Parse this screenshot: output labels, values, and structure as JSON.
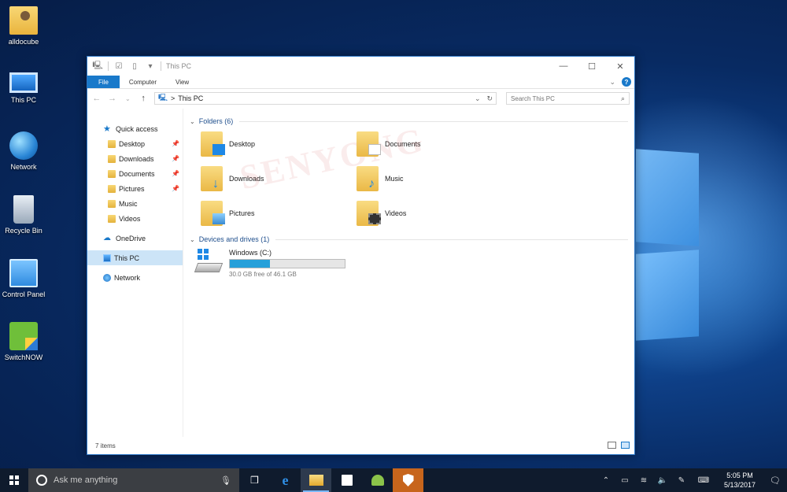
{
  "desktop": {
    "icons": [
      {
        "label": "alldocube",
        "icon": "user-folder-icon"
      },
      {
        "label": "This PC",
        "icon": "computer-icon"
      },
      {
        "label": "Network",
        "icon": "network-icon"
      },
      {
        "label": "Recycle Bin",
        "icon": "recycle-bin-icon"
      },
      {
        "label": "Control Panel",
        "icon": "control-panel-icon"
      },
      {
        "label": "SwitchNOW",
        "icon": "switchnow-icon"
      }
    ]
  },
  "window": {
    "title": "This PC",
    "controls": {
      "minimize": "—",
      "maximize": "☐",
      "close": "✕"
    },
    "ribbon_tabs": [
      "File",
      "Computer",
      "View"
    ],
    "address": {
      "path": "This PC",
      "separator": ">"
    },
    "search": {
      "placeholder": "Search This PC"
    },
    "nav_pane": {
      "quick_access": "Quick access",
      "quick_items": [
        {
          "label": "Desktop",
          "pinned": true
        },
        {
          "label": "Downloads",
          "pinned": true
        },
        {
          "label": "Documents",
          "pinned": true
        },
        {
          "label": "Pictures",
          "pinned": true
        },
        {
          "label": "Music",
          "pinned": false
        },
        {
          "label": "Videos",
          "pinned": false
        }
      ],
      "onedrive": "OneDrive",
      "this_pc": "This PC",
      "network": "Network"
    },
    "folders_section": "Folders (6)",
    "folders": [
      {
        "label": "Desktop",
        "badge": "desktop"
      },
      {
        "label": "Documents",
        "badge": "documents"
      },
      {
        "label": "Downloads",
        "badge": "downloads"
      },
      {
        "label": "Music",
        "badge": "music"
      },
      {
        "label": "Pictures",
        "badge": "pictures"
      },
      {
        "label": "Videos",
        "badge": "videos"
      }
    ],
    "devices_section": "Devices and drives (1)",
    "drive": {
      "name": "Windows (C:)",
      "free_text": "30.0 GB free of 46.1 GB",
      "used_fraction": 0.35
    },
    "watermark": "SENYONG",
    "status": "7 items"
  },
  "taskbar": {
    "search_placeholder": "Ask me anything",
    "time": "5:05 PM",
    "date": "5/13/2017"
  },
  "colors": {
    "accent": "#1979ca",
    "drive_fill": "#26a0da",
    "taskbar": "#0f1b2d",
    "defender": "#c7651c"
  }
}
